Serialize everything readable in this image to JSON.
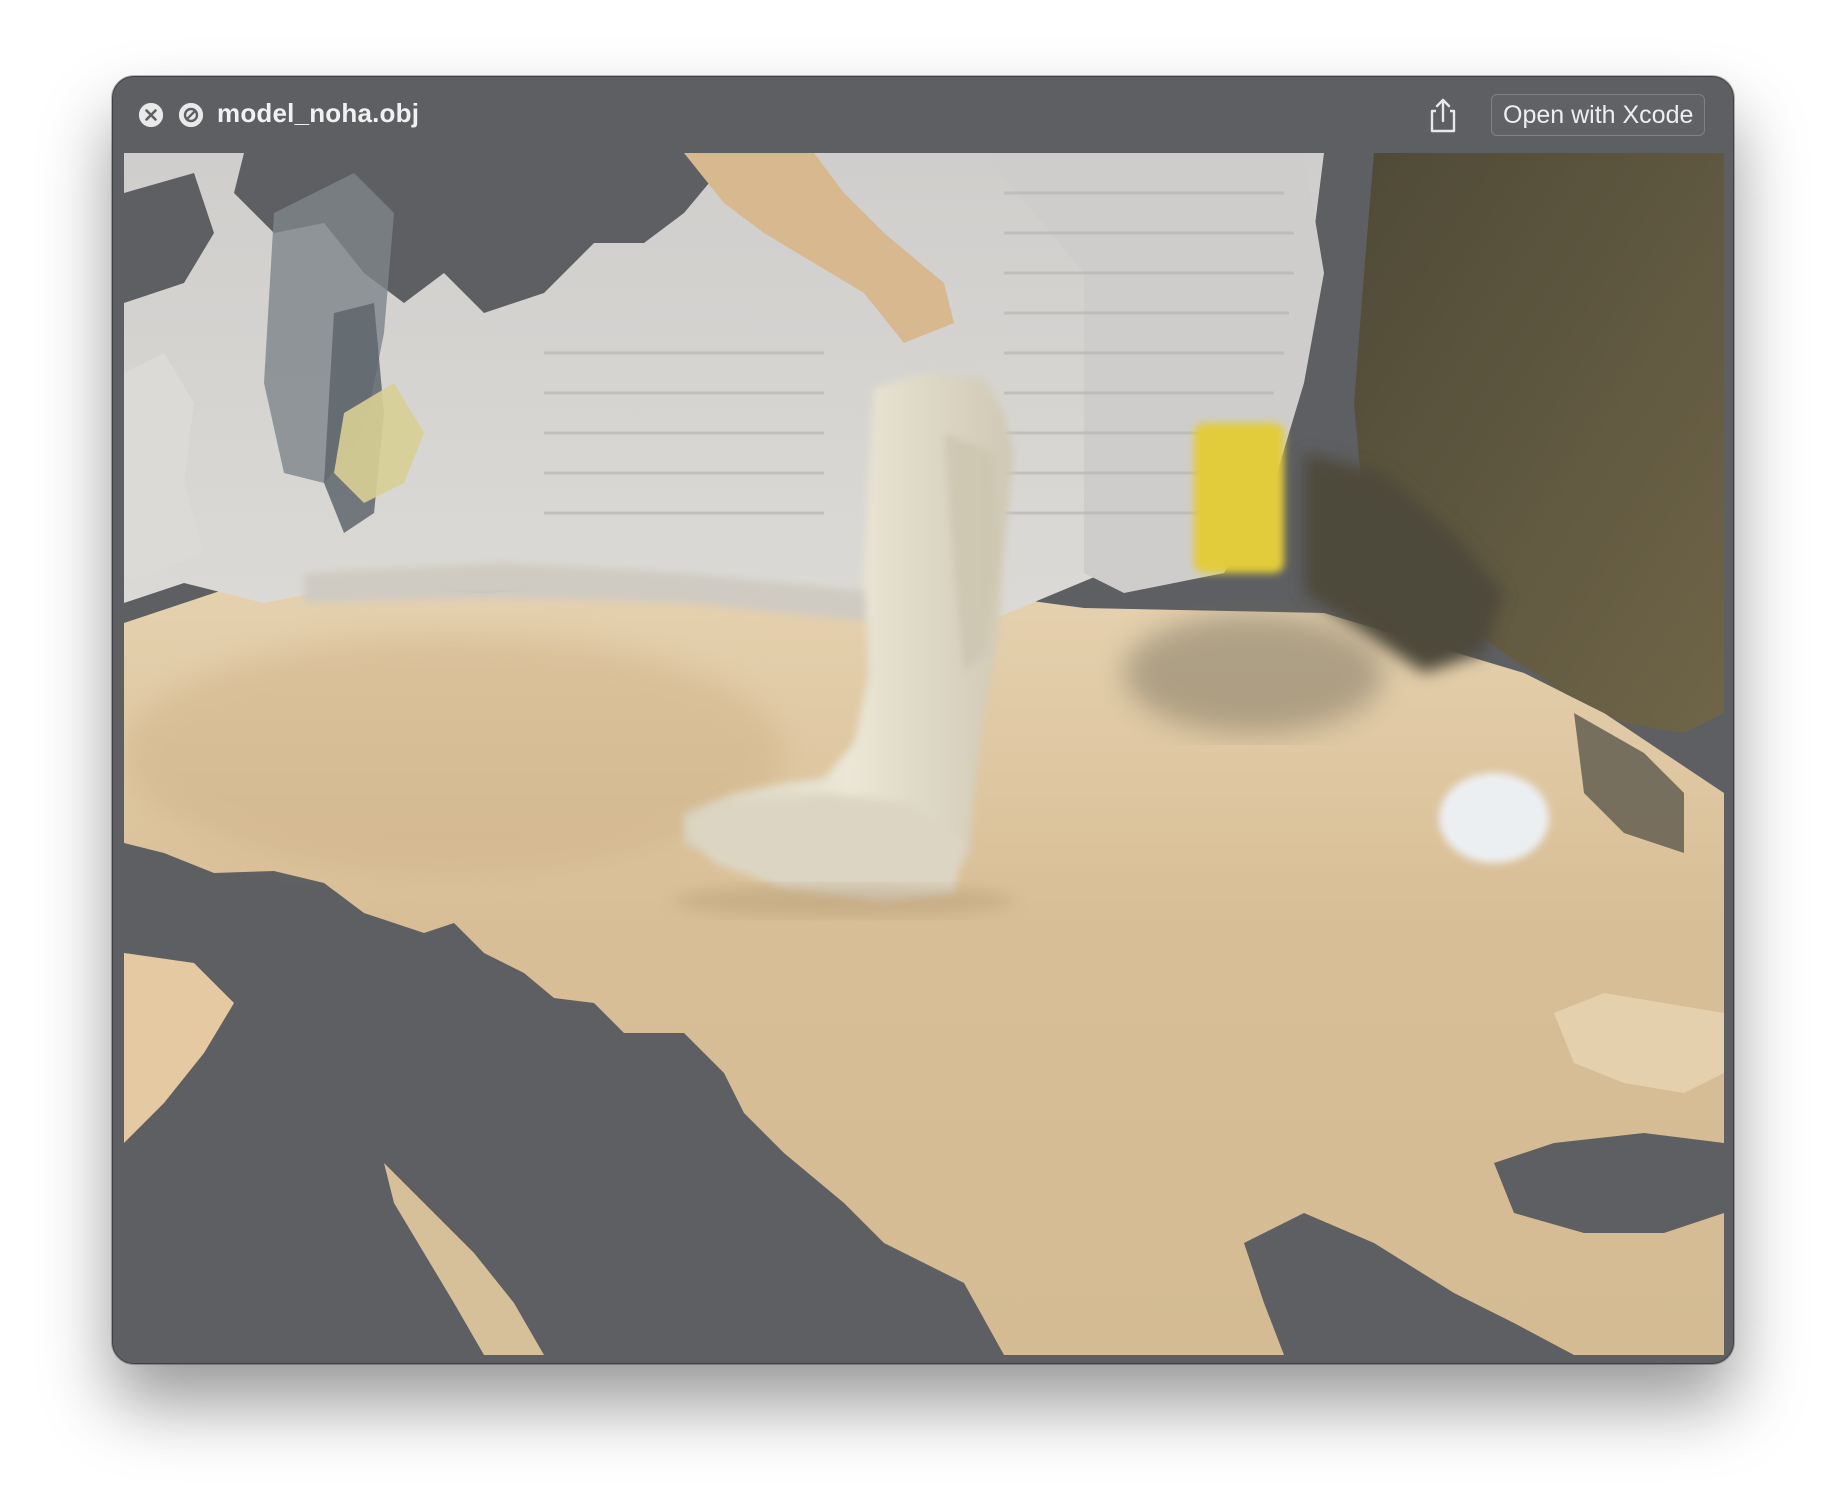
{
  "window": {
    "title": "model_noha.obj",
    "open_button_label": "Open with Xcode"
  },
  "icons": {
    "close": "close-circle-icon",
    "hide": "slash-circle-icon",
    "share": "share-icon"
  },
  "colors": {
    "window_background": "#5e5f62",
    "title_text": "#f1f1f2",
    "floor": "#d9bf98",
    "walls": "#d4d2cf",
    "boot": "#e2dccb",
    "yellow_object": "#e2cc3a",
    "dark_panel": "#6b6146"
  }
}
